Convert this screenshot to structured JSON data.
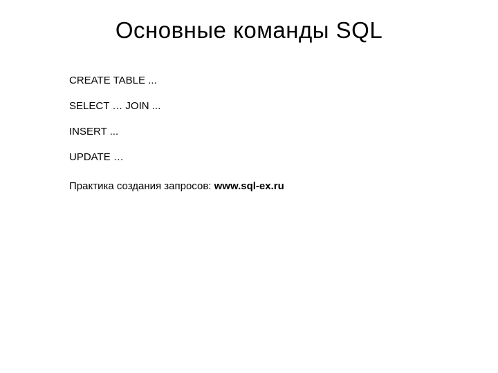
{
  "title": "Основные команды SQL",
  "commands": {
    "c0": "CREATE TABLE ...",
    "c1": "SELECT … JOIN ...",
    "c2": "INSERT ...",
    "c3": "UPDATE …"
  },
  "practice": {
    "label": "Практика создания запросов: ",
    "link": "www.sql-ex.ru"
  }
}
